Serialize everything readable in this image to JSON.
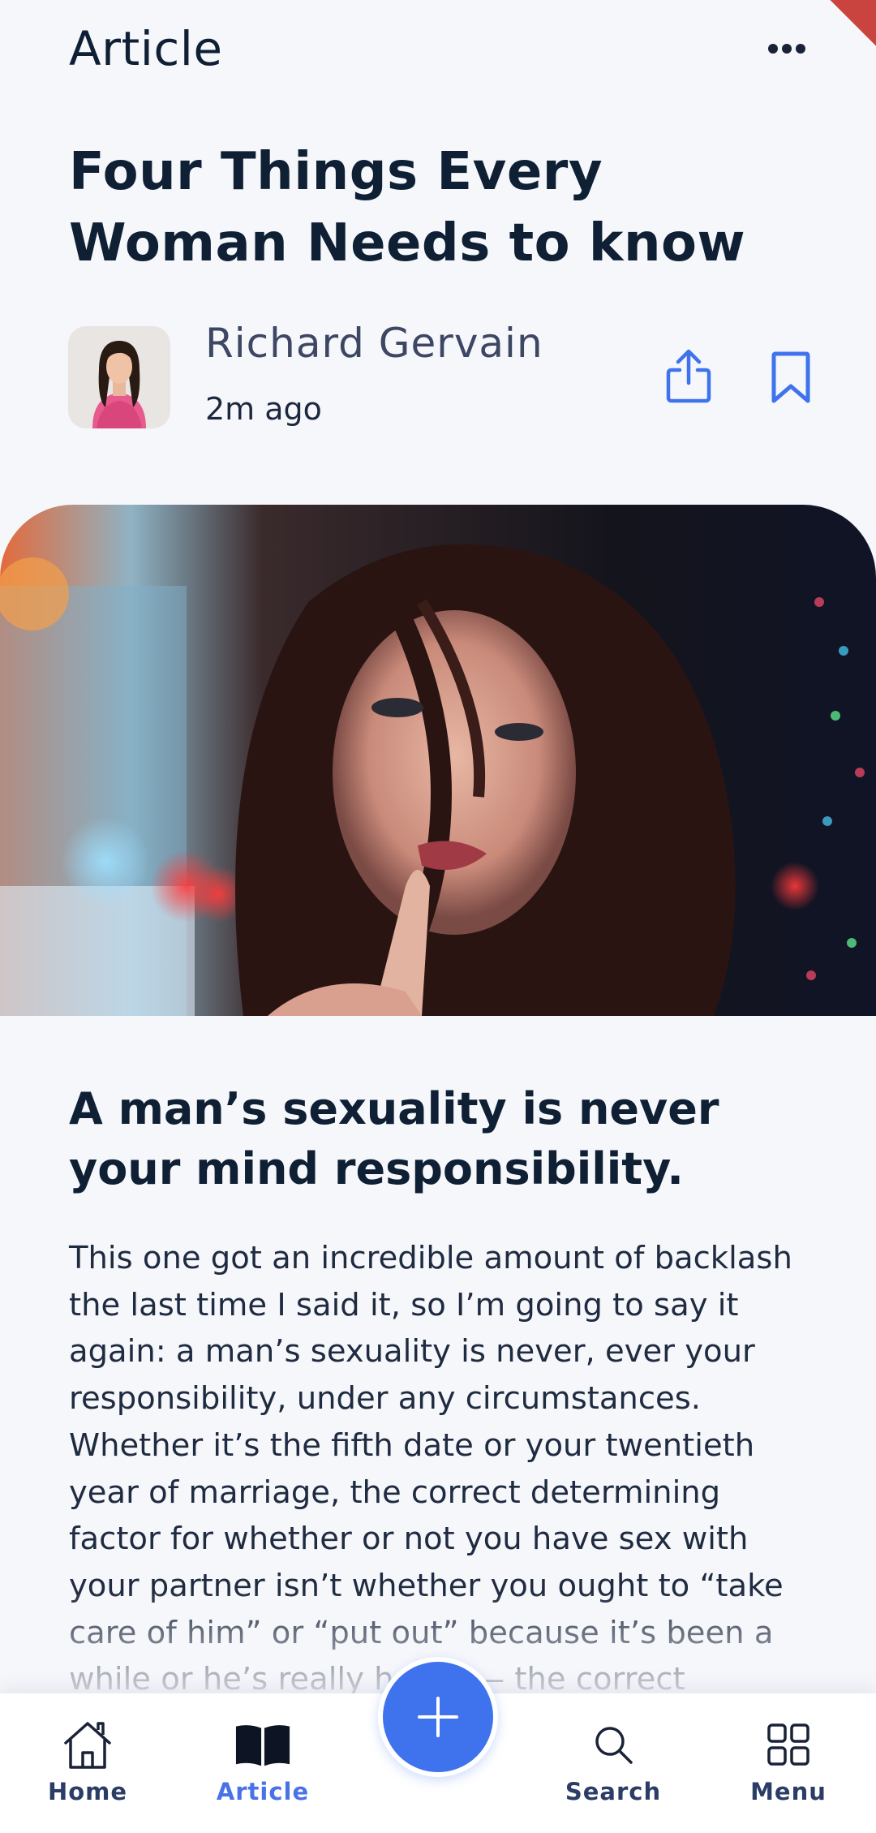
{
  "header": {
    "title": "Article"
  },
  "article": {
    "title": "Four Things Every Woman Needs to know",
    "author": {
      "name": "Richard Gervain",
      "time": "2m ago"
    },
    "section_heading": "A man’s sexuality is never your mind responsibility.",
    "body": "This one got an incredible amount of backlash the last time I said it, so I’m going to say it again: a man’s sexuality is never, ever your responsibility, under any circumstances. Whether it’s the fifth date or your twentieth year of marriage, the correct determining factor for whether or not you have sex with your partner isn’t whether you ought to “take care of him” or “put out” because it’s been a while or he’s really horny — the correct determining factor for"
  },
  "bottom_nav": {
    "items": [
      {
        "label": "Home",
        "icon": "home-icon"
      },
      {
        "label": "Article",
        "icon": "book-icon"
      },
      {
        "label": "Search",
        "icon": "search-icon"
      },
      {
        "label": "Menu",
        "icon": "grid-icon"
      }
    ],
    "active": "Article"
  },
  "colors": {
    "accent": "#3f73ee",
    "active_label": "#4a72e8",
    "text_dark": "#0f2035",
    "background": "#f6f7fb"
  }
}
